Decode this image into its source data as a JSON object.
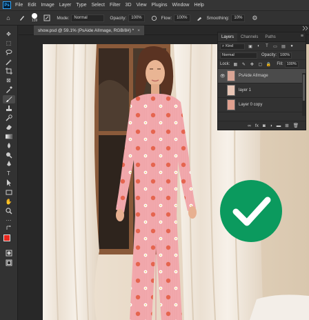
{
  "menubar": {
    "logo": "Ps",
    "items": [
      "File",
      "Edit",
      "Image",
      "Layer",
      "Type",
      "Select",
      "Filter",
      "3D",
      "View",
      "Plugins",
      "Window",
      "Help"
    ]
  },
  "options": {
    "brush_size": "139",
    "mode_label": "Mode:",
    "mode_value": "Normal",
    "opacity_label": "Opacity:",
    "opacity_value": "100%",
    "flow_label": "Flow:",
    "flow_value": "100%",
    "smoothing_label": "Smoothing:",
    "smoothing_value": "10%"
  },
  "document": {
    "tab_title": "show.psd @ 59.1% (PsAide AIImage, RGB/8#) *",
    "close": "×"
  },
  "layers_panel": {
    "tabs": [
      "Layers",
      "Channels",
      "Paths"
    ],
    "kind_label": "Kind",
    "blend_mode": "Normal",
    "opacity_label": "Opacity:",
    "opacity_value": "100%",
    "lock_label": "Lock:",
    "fill_label": "Fill:",
    "fill_value": "100%",
    "layers": [
      {
        "name": "PsAide AIImage",
        "visible": true,
        "selected": true
      },
      {
        "name": "layer 1",
        "visible": false,
        "selected": false
      },
      {
        "name": "Layer 0 copy",
        "visible": false,
        "selected": false
      }
    ],
    "footer_icons": [
      "link-icon",
      "fx-icon",
      "mask-icon",
      "adjustment-icon",
      "folder-icon",
      "new-layer-icon",
      "trash-icon"
    ]
  },
  "colors": {
    "foreground": "#e8261d",
    "background": "#ffffff",
    "check_badge": "#0b9a5e",
    "accent": "#31a8ff"
  }
}
